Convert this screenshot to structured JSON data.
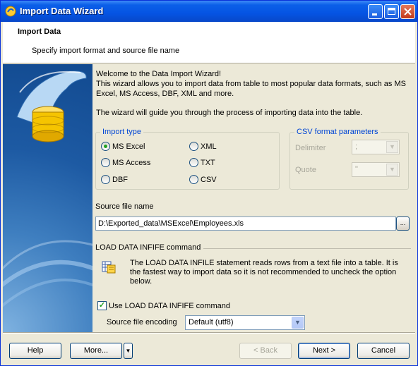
{
  "window": {
    "title": "Import Data Wizard"
  },
  "header": {
    "title": "Import Data",
    "subtitle": "Specify import format and source file name"
  },
  "intro": {
    "line1": "Welcome to the Data Import Wizard!",
    "line2": "This wizard allows you to import data from table to most popular data formats, such as MS Excel, MS Access, DBF, XML and more.",
    "line3": "The wizard will guide you through the process of importing data into the table."
  },
  "import_type": {
    "legend": "Import type",
    "options": [
      "MS Excel",
      "XML",
      "MS Access",
      "TXT",
      "DBF",
      "CSV"
    ],
    "selected": "MS Excel"
  },
  "csv_params": {
    "legend": "CSV format parameters",
    "delimiter_label": "Delimiter",
    "delimiter_value": ";",
    "quote_label": "Quote",
    "quote_value": "\""
  },
  "source": {
    "label": "Source file name",
    "value": "D:\\Exported_data\\MSExcel\\Employees.xls",
    "browse_label": "..."
  },
  "load_data": {
    "section_title": "LOAD DATA INFIFE command",
    "info": "The LOAD DATA INFILE statement reads rows from a text file into a table. It is the fastest way to import data so it is not recommended to uncheck the option below.",
    "checkbox_label": "Use LOAD DATA INFIFE command",
    "checked": true,
    "encoding_label": "Source file encoding",
    "encoding_value": "Default (utf8)"
  },
  "buttons": {
    "help": "Help",
    "more": "More...",
    "back": "< Back",
    "next": "Next >",
    "cancel": "Cancel"
  },
  "colors": {
    "accent": "#0046d5",
    "titlebar": "#0554e3"
  }
}
